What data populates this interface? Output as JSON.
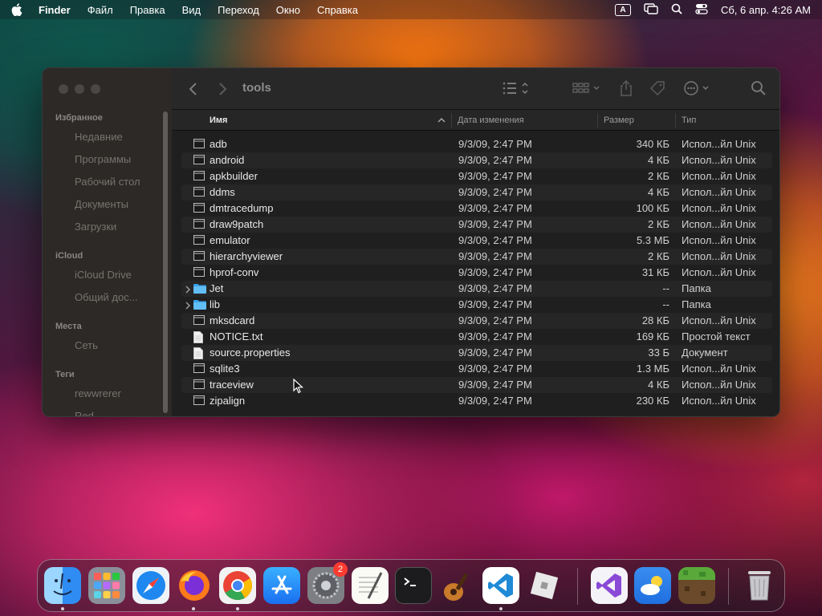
{
  "menubar": {
    "app_name": "Finder",
    "items": [
      "Файл",
      "Правка",
      "Вид",
      "Переход",
      "Окно",
      "Справка"
    ],
    "input_indicator": "A",
    "clock": "Сб, 6 апр.  4:26 AM"
  },
  "sidebar": {
    "favorites_title": "Избранное",
    "favorites": [
      "Недавние",
      "Программы",
      "Рабочий стол",
      "Документы",
      "Загрузки"
    ],
    "icloud_title": "iCloud",
    "icloud": [
      "iCloud Drive",
      "Общий дос..."
    ],
    "locations_title": "Места",
    "locations": [
      "Сеть"
    ],
    "tags_title": "Теги",
    "tags": [
      "rewwrerer",
      "Red"
    ]
  },
  "toolbar": {
    "title": "tools"
  },
  "table": {
    "columns": {
      "name": "Имя",
      "date": "Дата изменения",
      "size": "Размер",
      "type": "Тип"
    },
    "rows": [
      {
        "name": "adb",
        "date": "9/3/09, 2:47 PM",
        "size": "340 КБ",
        "type": "Испол...йл Unix",
        "kind": "exec"
      },
      {
        "name": "android",
        "date": "9/3/09, 2:47 PM",
        "size": "4 КБ",
        "type": "Испол...йл Unix",
        "kind": "exec"
      },
      {
        "name": "apkbuilder",
        "date": "9/3/09, 2:47 PM",
        "size": "2 КБ",
        "type": "Испол...йл Unix",
        "kind": "exec"
      },
      {
        "name": "ddms",
        "date": "9/3/09, 2:47 PM",
        "size": "4 КБ",
        "type": "Испол...йл Unix",
        "kind": "exec"
      },
      {
        "name": "dmtracedump",
        "date": "9/3/09, 2:47 PM",
        "size": "100 КБ",
        "type": "Испол...йл Unix",
        "kind": "exec"
      },
      {
        "name": "draw9patch",
        "date": "9/3/09, 2:47 PM",
        "size": "2 КБ",
        "type": "Испол...йл Unix",
        "kind": "exec"
      },
      {
        "name": "emulator",
        "date": "9/3/09, 2:47 PM",
        "size": "5.3 МБ",
        "type": "Испол...йл Unix",
        "kind": "exec"
      },
      {
        "name": "hierarchyviewer",
        "date": "9/3/09, 2:47 PM",
        "size": "2 КБ",
        "type": "Испол...йл Unix",
        "kind": "exec"
      },
      {
        "name": "hprof-conv",
        "date": "9/3/09, 2:47 PM",
        "size": "31 КБ",
        "type": "Испол...йл Unix",
        "kind": "exec"
      },
      {
        "name": "Jet",
        "date": "9/3/09, 2:47 PM",
        "size": "--",
        "type": "Папка",
        "kind": "folder"
      },
      {
        "name": "lib",
        "date": "9/3/09, 2:47 PM",
        "size": "--",
        "type": "Папка",
        "kind": "folder"
      },
      {
        "name": "mksdcard",
        "date": "9/3/09, 2:47 PM",
        "size": "28 КБ",
        "type": "Испол...йл Unix",
        "kind": "exec"
      },
      {
        "name": "NOTICE.txt",
        "date": "9/3/09, 2:47 PM",
        "size": "169 КБ",
        "type": "Простой текст",
        "kind": "doc"
      },
      {
        "name": "source.properties",
        "date": "9/3/09, 2:47 PM",
        "size": "33 Б",
        "type": "Документ",
        "kind": "doc"
      },
      {
        "name": "sqlite3",
        "date": "9/3/09, 2:47 PM",
        "size": "1.3 МБ",
        "type": "Испол...йл Unix",
        "kind": "exec"
      },
      {
        "name": "traceview",
        "date": "9/3/09, 2:47 PM",
        "size": "4 КБ",
        "type": "Испол...йл Unix",
        "kind": "exec"
      },
      {
        "name": "zipalign",
        "date": "9/3/09, 2:47 PM",
        "size": "230 КБ",
        "type": "Испол...йл Unix",
        "kind": "exec"
      }
    ]
  },
  "dock": {
    "settings_badge": "2",
    "icons": [
      "finder-icon",
      "launchpad-icon",
      "safari-icon",
      "firefox-icon",
      "chrome-icon",
      "app-store-icon",
      "system-settings-icon",
      "textedit-icon",
      "terminal-icon",
      "garageband-icon",
      "vscode-icon",
      "roblox-icon",
      "visual-studio-icon",
      "weather-icon",
      "minecraft-icon",
      "trash-icon"
    ]
  },
  "colors": {
    "folder": "#3aa0e8",
    "badge": "#ff3b30",
    "window_bg": "#1f1f1f",
    "sidebar_bg": "#2c2926"
  }
}
